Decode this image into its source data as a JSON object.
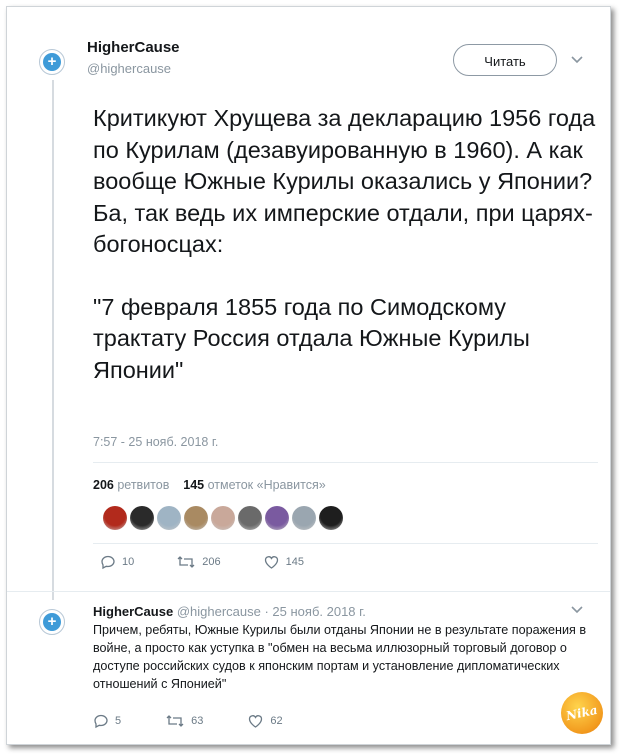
{
  "main_tweet": {
    "author_name": "HigherCause",
    "author_handle": "@highercause",
    "follow_label": "Читать",
    "text_paragraph": "Критикуют Хрущева за декларацию 1956 года по Курилам (дезавуированную в 1960). А как вообще Южные Курилы оказались у Японии? Ба, так ведь их имперские отдали, при царях-богоносцах:",
    "text_quote": "\"7 февраля 1855 года по Симодскому трактату Россия отдала Южные Курилы Японии\"",
    "timestamp": "7:57 - 25 нояб. 2018 г.",
    "retweets_count": "206",
    "retweets_label": "ретвитов",
    "likes_count": "145",
    "likes_label": "отметок «Нравится»",
    "actions": {
      "replies": "10",
      "retweets": "206",
      "likes": "145"
    }
  },
  "likers": [
    {
      "icon": "avatar-emblem",
      "color": "#b22a1c"
    },
    {
      "icon": "avatar-dark-figure",
      "color": "#2a2a2a"
    },
    {
      "icon": "avatar-outdoor",
      "color": "#9fb4c4"
    },
    {
      "icon": "avatar-cat",
      "color": "#a98a62"
    },
    {
      "icon": "avatar-person",
      "color": "#c9a89a"
    },
    {
      "icon": "avatar-crowd",
      "color": "#6a6a6a"
    },
    {
      "icon": "avatar-purple",
      "color": "#7a5aa0"
    },
    {
      "icon": "avatar-default",
      "color": "#9aa6b0"
    },
    {
      "icon": "avatar-dark",
      "color": "#1e1e1e"
    }
  ],
  "reply_tweet": {
    "author_name": "HigherCause",
    "author_handle": "@highercause",
    "date": "· 25 нояб. 2018 г.",
    "text": "Причем, ребяты, Южные Курилы были отданы Японии не в результате поражения в войне, а просто как уступка в \"обмен на весьма иллюзорный торговый договор о доступе российских судов к японским портам и установление дипломатических отношений с Японией\"",
    "actions": {
      "replies": "5",
      "retweets": "63",
      "likes": "62"
    }
  },
  "watermark_text": "Nika"
}
